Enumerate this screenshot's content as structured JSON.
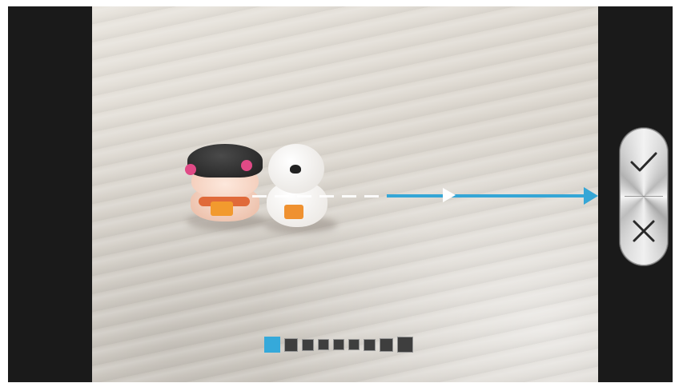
{
  "screen": {
    "mode": "panorama-capture"
  },
  "pan_guide": {
    "direction": "right",
    "accent_color": "#35a6d6"
  },
  "panorama_progress": {
    "total_segments": 9,
    "captured_segments": 1,
    "active_color": "#35a9da"
  },
  "controls": {
    "accept_icon": "checkmark-icon",
    "cancel_icon": "close-icon"
  }
}
